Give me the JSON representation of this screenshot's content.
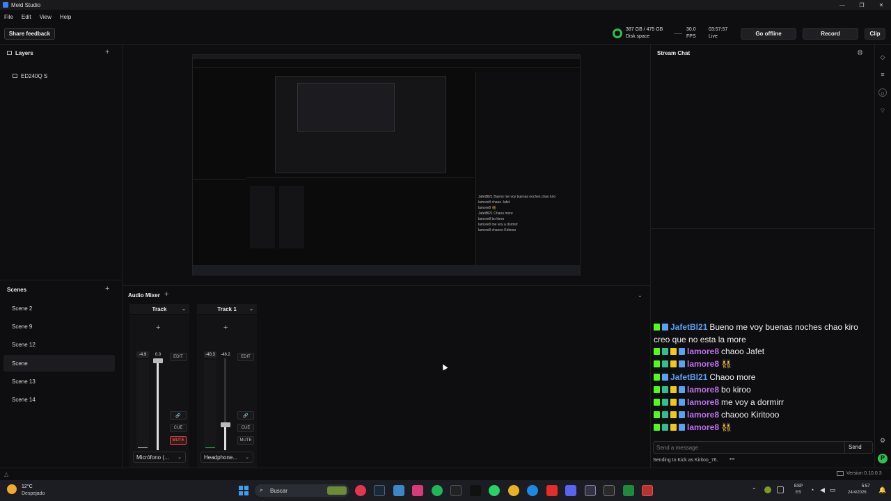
{
  "window": {
    "title": "Meld Studio",
    "min": "—",
    "max": "❐",
    "close": "✕"
  },
  "menu": [
    "File",
    "Edit",
    "View",
    "Help"
  ],
  "toolbar": {
    "share_feedback": "Share feedback",
    "disk_value": "387 GB / 475 GB",
    "disk_label": "Disk space",
    "fps_value": "30.0",
    "fps_label": "FPS",
    "time_value": "03:57:57",
    "time_label": "Live",
    "go_offline": "Go offline",
    "record": "Record",
    "clip": "Clip"
  },
  "layers": {
    "title": "Layers",
    "items": [
      "ED240Q S"
    ]
  },
  "scenes": {
    "title": "Scenes",
    "items": [
      "Scene 2",
      "Scene 9",
      "Scene 12",
      "Scene",
      "Scene 13",
      "Scene 14"
    ],
    "selected": "Scene"
  },
  "mixer": {
    "title": "Audio Mixer",
    "tracks": [
      {
        "name": "Track",
        "peak": "-4.9",
        "gain": "0.0",
        "device": "Micrófono (...",
        "edit": "EDIT",
        "cue": "CUE",
        "mute": "MUTE",
        "muted": true
      },
      {
        "name": "Track 1",
        "peak": "-40.3",
        "gain": "-48.2",
        "device": "Headphone...",
        "edit": "EDIT",
        "cue": "CUE",
        "mute": "MUTE",
        "muted": false
      }
    ]
  },
  "chat": {
    "title": "Stream Chat",
    "messages": [
      {
        "user": "JafetBl21",
        "color": "#5aa0f5",
        "text": "Bueno me voy buenas noches chao kiro creo que no esta la more"
      },
      {
        "user": "lamore8",
        "color": "#c070f0",
        "text": "chaoo Jafet"
      },
      {
        "user": "lamore8",
        "color": "#c070f0",
        "text": "👯"
      },
      {
        "user": "JafetBl21",
        "color": "#5aa0f5",
        "text": "Chaoo more"
      },
      {
        "user": "lamore8",
        "color": "#c070f0",
        "text": "bo kiroo"
      },
      {
        "user": "lamore8",
        "color": "#c070f0",
        "text": "me voy a dormirr"
      },
      {
        "user": "lamore8",
        "color": "#c070f0",
        "text": "chaooo Kiritooo"
      },
      {
        "user": "lamore8",
        "color": "#c070f0",
        "text": "👯"
      }
    ],
    "input_placeholder": "Send a message",
    "send": "Send",
    "sending_to": "Sending to Kick as Kiritoo_76."
  },
  "status": {
    "version": "Version 0.10.0.3"
  },
  "taskbar": {
    "weather_temp": "12°C",
    "weather_desc": "Despejado",
    "search": "Buscar",
    "lang": "ESP",
    "lang_sub": "ES",
    "time": "5:57",
    "date": "24/4/2026"
  },
  "accent_green": "#2fbf4f",
  "kick_green": "#53fc18"
}
